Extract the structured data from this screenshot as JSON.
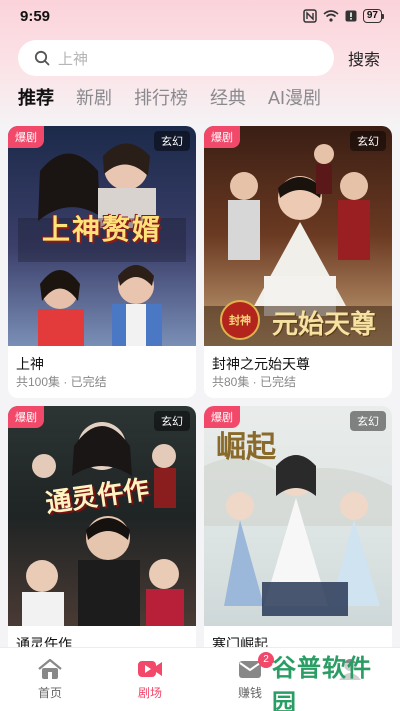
{
  "status": {
    "time": "9:59",
    "battery": "97"
  },
  "search": {
    "placeholder": "上神",
    "button": "搜索"
  },
  "tabs": [
    "推荐",
    "新剧",
    "排行榜",
    "经典",
    "AI漫剧"
  ],
  "cards": [
    {
      "title": "上神",
      "meta": "共100集 · 已完结",
      "badge": "爆剧",
      "genre": "玄幻",
      "poster_text": "上神赘婿"
    },
    {
      "title": "封神之元始天尊",
      "meta": "共80集 · 已完结",
      "badge": "爆剧",
      "genre": "玄幻",
      "poster_text": "元始天尊"
    },
    {
      "title": "通灵仵作",
      "meta": "",
      "badge": "爆剧",
      "genre": "玄幻",
      "poster_text": "通灵仵作"
    },
    {
      "title": "寒门崛起",
      "meta": "",
      "badge": "爆剧",
      "genre": "玄幻",
      "poster_text": "崛起"
    }
  ],
  "nav": [
    {
      "label": "首页",
      "icon": "home-icon"
    },
    {
      "label": "剧场",
      "icon": "theater-icon"
    },
    {
      "label": "赚钱",
      "icon": "mail-icon",
      "badge": "2"
    },
    {
      "label": "",
      "icon": "profile-icon"
    }
  ],
  "watermark": "谷普软件园",
  "colors": {
    "accent": "#f2486a",
    "watermark": "#2a9d64"
  }
}
